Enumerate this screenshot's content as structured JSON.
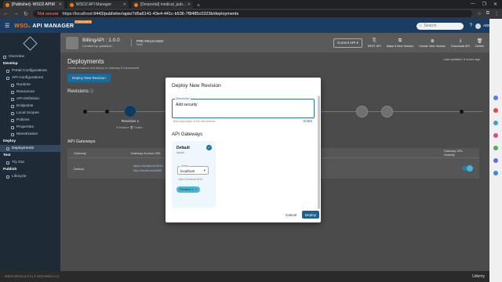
{
  "browser": {
    "tabs": [
      {
        "title": "[Publisher]- WSO2 APIM",
        "active": true
      },
      {
        "title": "WSO2 API Manager",
        "active": false
      },
      {
        "title": "[Devportal] medical_pub...",
        "active": false
      }
    ],
    "new_tab": "+",
    "window_controls": [
      "—",
      "❐",
      "✕"
    ],
    "not_secure": "Not secure",
    "url_host": "https://localhost",
    "url_path": ":9443/publisher/apis/7d5a6141-43e4-441c-b536-7f8485c0323b/deployments"
  },
  "header": {
    "logo_prefix": "WSO₂",
    "logo_text": "API MANAGER",
    "badge": "PUBLISHER",
    "search_placeholder": "Search",
    "user": "ADMIN ▾"
  },
  "sidebar": {
    "items": [
      {
        "label": "Overview",
        "level": 0,
        "type": "item"
      },
      {
        "label": "Develop",
        "level": 0,
        "type": "section"
      },
      {
        "label": "Portal Configurations",
        "level": 1,
        "type": "item"
      },
      {
        "label": "API Configurations",
        "level": 1,
        "type": "item"
      },
      {
        "label": "Runtime",
        "level": 2,
        "type": "item"
      },
      {
        "label": "Resources",
        "level": 2,
        "type": "item"
      },
      {
        "label": "API Definition",
        "level": 2,
        "type": "item"
      },
      {
        "label": "Endpoints",
        "level": 2,
        "type": "item"
      },
      {
        "label": "Local Scopes",
        "level": 2,
        "type": "item"
      },
      {
        "label": "Policies",
        "level": 2,
        "type": "item"
      },
      {
        "label": "Properties",
        "level": 2,
        "type": "item"
      },
      {
        "label": "Monetization",
        "level": 2,
        "type": "item"
      },
      {
        "label": "Deploy",
        "level": 0,
        "type": "section"
      },
      {
        "label": "Deployments",
        "level": 1,
        "type": "active"
      },
      {
        "label": "Test",
        "level": 0,
        "type": "section"
      },
      {
        "label": "Try Out",
        "level": 1,
        "type": "item"
      },
      {
        "label": "Publish",
        "level": 0,
        "type": "section"
      },
      {
        "label": "Lifecycle",
        "level": 1,
        "type": "item"
      }
    ]
  },
  "api_bar": {
    "name": "BillingAPI : 1.0.0",
    "created_by": "Created by: publisher",
    "status_label": "PRE-RELEASED",
    "status_sub": "State",
    "current_api": "Current API ▾",
    "actions": [
      {
        "icon": "⎘",
        "label": "REST API"
      },
      {
        "icon": "⧉",
        "label": "Make it New Version"
      },
      {
        "icon": "⊕",
        "label": "Create New Version"
      },
      {
        "icon": "⤓",
        "label": "Download API"
      },
      {
        "icon": "🗑",
        "label": "Delete"
      }
    ]
  },
  "deployments": {
    "title": "Deployments",
    "subtitle": "Create revisions and deploy in Gateway Environments",
    "last_updated": "Last updated: 9 hours ago",
    "new_revision_button": "Deploy New Revision",
    "revisions_label": "Revisions",
    "revision_name": "Revision 1",
    "revision_actions": "⟲ Restore   🗑 Delete",
    "gateways_label": "API Gateways",
    "table_headers": [
      "Gateway",
      "Gateway Access URL",
      "",
      "Gateway URL Visibility"
    ],
    "row": {
      "name": "Default",
      "url1": "https://localhost:8243",
      "url2": "http://localhost:8280"
    }
  },
  "modal": {
    "title": "Deploy New Revision",
    "description_label": "Description",
    "description_value": "Add security",
    "helper": "Brief description of the new revision",
    "counter": "0/255",
    "gateways_label": "API Gateways",
    "card": {
      "name": "Default",
      "type": "hybrid",
      "vhost_label": "VHost",
      "vhost_value": "localhost",
      "vhost_url": "https://localhost:8243",
      "revision_chip": "Revision 1"
    },
    "cancel": "Cancel",
    "deploy": "Deploy"
  },
  "footer": {
    "text": "WSO2 API-M v4.2.0 | © 2023 WSO2 LLC",
    "watermark": "Udemy"
  },
  "colors": {
    "header_bg": "#1a3d63",
    "accent": "#f47b20",
    "primary": "#1e5f8e"
  }
}
